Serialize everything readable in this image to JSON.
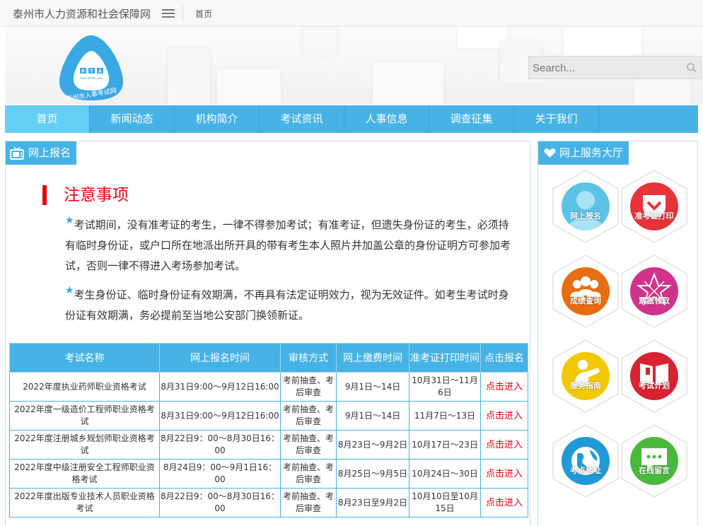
{
  "topbar": {
    "site_name": "泰州市人力资源和社会保障网",
    "breadcrumb": "首页"
  },
  "banner": {
    "logo": {
      "letters": "PTA",
      "url": "www.tzrsks.com",
      "name": "泰州市人事考试网"
    },
    "search_placeholder": "Search..."
  },
  "nav": {
    "items": [
      "首页",
      "新闻动态",
      "机构简介",
      "考试资讯",
      "人事信息",
      "调查征集",
      "关于我们"
    ],
    "active_index": 0
  },
  "main": {
    "section_title": "网上报名",
    "notice_title": "注意事项",
    "paragraphs": [
      "考试期间，没有准考证的考生，一律不得参加考试；有准考证，但遗失身份证的考生，必须持有临时身份证，或户口所在地派出所开具的带有考生本人照片并加盖公章的身份证明方可参加考试，否则一律不得进入考场参加考试。",
      "考生身份证、临时身份证有效期满，不再具有法定证明效力，视为无效证件。如考生考试时身份证有效期满，务必提前至当地公安部门换领新证。"
    ],
    "table": {
      "headers": [
        "考试名称",
        "网上报名时间",
        "审核方式",
        "网上缴费时间",
        "准考证打印时间",
        "点击报名"
      ],
      "rows": [
        [
          "2022年度执业药师职业资格考试",
          "8月31日9:00～9月12日16:00",
          "考前抽查、考后审查",
          "9月1日～14日",
          "10月31日～11月6日",
          "点击进入"
        ],
        [
          "2022年度一级造价工程师职业资格考试",
          "8月31日9:00～9月12日16:00",
          "考前抽查、考后审查",
          "9月1日～14日",
          "11月7日～13日",
          "点击进入"
        ],
        [
          "2022年度注册城乡规划师职业资格考试",
          "8月22日9：00～8月30日16：00",
          "考前抽查、考后审查",
          "8月23日～9月2日",
          "10月17日～23日",
          "点击进入"
        ],
        [
          "2022年度中级注册安全工程师职业资格考试",
          "8月24日9：00～9月1日16：00",
          "考前抽查、考后审查",
          "8月25日～9月5日",
          "10月24日～30日",
          "点击进入"
        ],
        [
          "2022年度出版专业技术人员职业资格考试",
          "8月22日9：00～8月30日16：00",
          "考前抽查、考后审查",
          "8月23日至9月2日",
          "10月10日至10月15日",
          "点击进入"
        ]
      ]
    }
  },
  "side": {
    "title": "网上服务大厅",
    "services": [
      {
        "label": "网上报名",
        "icon": "user-icon",
        "color": "#5cc2e8"
      },
      {
        "label": "准考证打印",
        "icon": "pocket-icon",
        "color": "#e8333a"
      },
      {
        "label": "成绩查询",
        "icon": "group-icon",
        "color": "#e86d12"
      },
      {
        "label": "票据领取",
        "icon": "star-icon",
        "color": "#d0338a"
      },
      {
        "label": "服务指南",
        "icon": "pointer-icon",
        "color": "#f2c800"
      },
      {
        "label": "考试计划",
        "icon": "book-icon",
        "color": "#d82232"
      },
      {
        "label": "考点地址",
        "icon": "globe-icon",
        "color": "#1f9ad6"
      },
      {
        "label": "在线留言",
        "icon": "chat-icon",
        "color": "#49b83c"
      }
    ]
  }
}
